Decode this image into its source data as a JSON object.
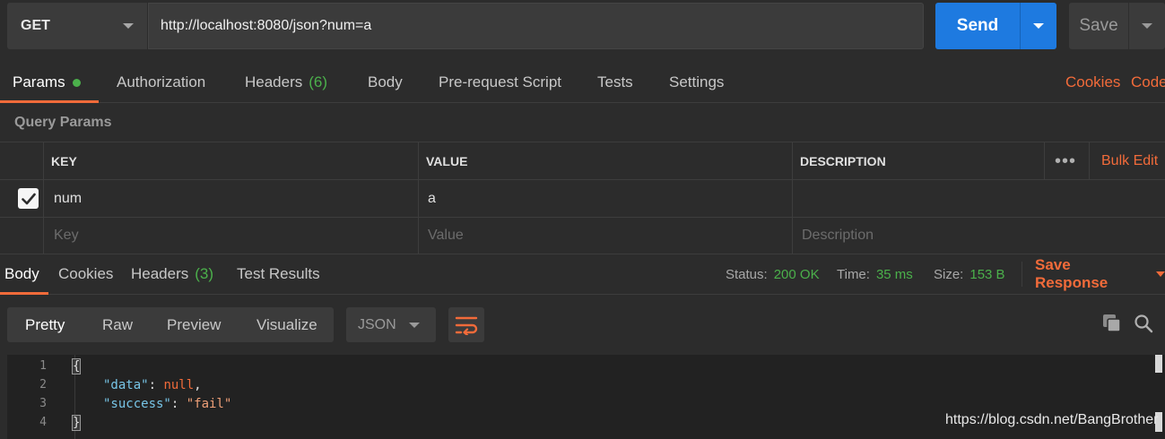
{
  "request": {
    "method": "GET",
    "url": "http://localhost:8080/json?num=a",
    "send_label": "Send",
    "save_label": "Save"
  },
  "request_tabs": [
    {
      "label": "Params",
      "active": true
    },
    {
      "label": "Authorization"
    },
    {
      "label": "Headers",
      "count": "(6)"
    },
    {
      "label": "Body"
    },
    {
      "label": "Pre-request Script"
    },
    {
      "label": "Tests"
    },
    {
      "label": "Settings"
    }
  ],
  "right_links": {
    "cookies": "Cookies",
    "code": "Code"
  },
  "query_params": {
    "title": "Query Params",
    "headers": {
      "key": "KEY",
      "value": "VALUE",
      "description": "DESCRIPTION"
    },
    "more": "•••",
    "bulk_edit": "Bulk Edit",
    "rows": [
      {
        "checked": true,
        "key": "num",
        "value": "a",
        "description": ""
      }
    ],
    "placeholders": {
      "key": "Key",
      "value": "Value",
      "description": "Description"
    }
  },
  "response_tabs": [
    {
      "label": "Body",
      "active": true
    },
    {
      "label": "Cookies"
    },
    {
      "label": "Headers",
      "count": "(3)"
    },
    {
      "label": "Test Results"
    }
  ],
  "status": {
    "status_label": "Status:",
    "status_value": "200 OK",
    "time_label": "Time:",
    "time_value": "35 ms",
    "size_label": "Size:",
    "size_value": "153 B"
  },
  "save_response": "Save Response",
  "format_buttons": [
    {
      "label": "Pretty",
      "active": true
    },
    {
      "label": "Raw"
    },
    {
      "label": "Preview"
    },
    {
      "label": "Visualize"
    }
  ],
  "format_select": "JSON",
  "code_lines": [
    {
      "num": "1"
    },
    {
      "num": "2"
    },
    {
      "num": "3"
    },
    {
      "num": "4"
    }
  ],
  "code": {
    "open_brace": "{",
    "key1": "\"data\"",
    "colon1": ": ",
    "val1": "null",
    "comma1": ",",
    "key2": "\"success\"",
    "colon2": ": ",
    "val2": "\"fail\"",
    "close_brace": "}"
  },
  "watermark": "https://blog.csdn.net/BangBrother",
  "colors": {
    "accent": "#f26b3a",
    "send": "#1e7ae0",
    "success": "#4bb04b"
  },
  "icons": [
    "chevron-down-icon",
    "checkbox-check-icon",
    "wrap-lines-icon",
    "copy-icon",
    "search-icon"
  ]
}
